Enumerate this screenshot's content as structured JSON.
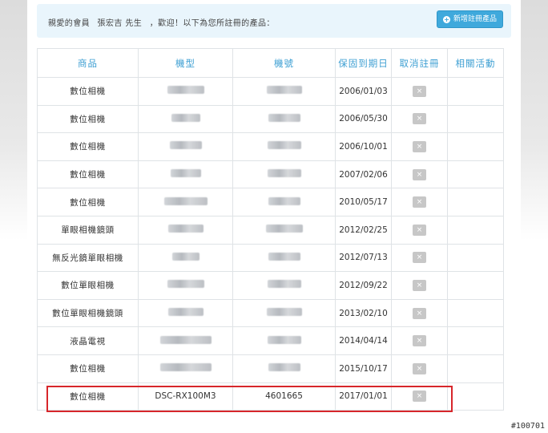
{
  "welcome": {
    "greeting": "親愛的會員",
    "member_name": "張宏吉 先生",
    "message": "，歡迎！以下為您所註冊的產品："
  },
  "add_button": {
    "icon": "plus-circle-icon",
    "label": "新增註冊產品"
  },
  "table": {
    "headers": [
      "商品",
      "機型",
      "機號",
      "保固到期日",
      "取消註冊",
      "相關活動"
    ],
    "rows": [
      {
        "product": "數位相機",
        "date": "2006/01/03"
      },
      {
        "product": "數位相機",
        "date": "2006/05/30"
      },
      {
        "product": "數位相機",
        "date": "2006/10/01"
      },
      {
        "product": "數位相機",
        "date": "2007/02/06"
      },
      {
        "product": "數位相機",
        "date": "2010/05/17"
      },
      {
        "product": "單眼相機鏡頭",
        "date": "2012/02/25"
      },
      {
        "product": "無反光鏡單眼相機",
        "date": "2012/07/13"
      },
      {
        "product": "數位單眼相機",
        "date": "2012/09/22"
      },
      {
        "product": "數位單眼相機鏡頭",
        "date": "2013/02/10"
      },
      {
        "product": "液晶電視",
        "date": "2014/04/14"
      },
      {
        "product": "數位相機",
        "date": "2015/10/17"
      },
      {
        "product": "數位相機",
        "model": "DSC-RX100M3",
        "serial": "4601665",
        "date": "2017/01/01"
      }
    ],
    "cancel_glyph": "×"
  },
  "watermark": "#100701",
  "colors": {
    "accent": "#3fa9dc",
    "highlight": "#d7262b",
    "cancel": "#c7c7c7"
  }
}
